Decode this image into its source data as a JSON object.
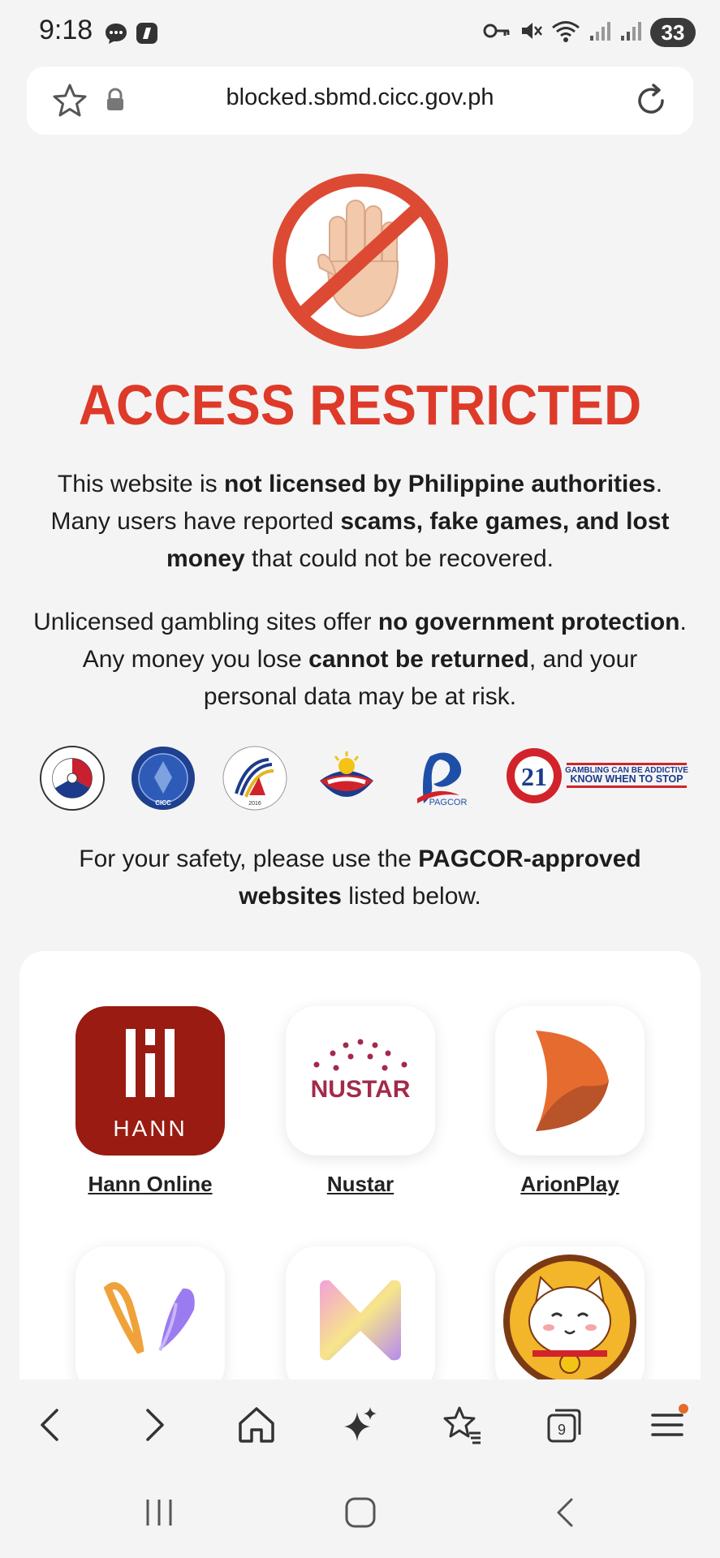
{
  "status_bar": {
    "time": "9:18",
    "left_icons": [
      "chat-bubble-icon",
      "app-notification-icon"
    ],
    "right_icons": [
      "vpn-key-icon",
      "mute-icon",
      "wifi-icon",
      "signal-icon",
      "signal-icon"
    ],
    "battery": "33"
  },
  "url_bar": {
    "url": "blocked.sbmd.cicc.gov.ph",
    "left_icons": [
      "star-icon",
      "lock-icon"
    ],
    "right_icon": "reload-icon"
  },
  "page": {
    "headline": "ACCESS RESTRICTED",
    "headline_color": "#de3a29",
    "para1": {
      "t1": "This website is ",
      "b1": "not licensed by Philippine authorities",
      "t2": ". Many users have reported ",
      "b2": "scams, fake games, and lost money",
      "t3": " that could not be recovered."
    },
    "para2": {
      "t1": "Unlicensed gambling sites offer ",
      "b1": "no government protection",
      "t2": ". Any money you lose ",
      "b2": "cannot be returned",
      "t3": ", and your personal data may be at risk."
    },
    "logos": {
      "ntc_text": "NATIONAL TELECOMMUNICATIONS COMMISSION",
      "cicc_text": "CICC",
      "dict_year": "2016",
      "pagcor_text": "PAGCOR",
      "age_number": "21",
      "warning_line1": "GAMBLING CAN BE ADDICTIVE",
      "warning_line2": "KNOW WHEN TO STOP"
    },
    "para3": {
      "t1": "For your safety, please use the ",
      "b1": "PAGCOR-approved websites",
      "t2": " listed below."
    }
  },
  "apps": [
    {
      "label": "Hann Online",
      "icon_text": "HANN"
    },
    {
      "label": "Nustar",
      "icon_text": "NUSTAR"
    },
    {
      "label": "ArionPlay"
    },
    {
      "label": ""
    },
    {
      "label": ""
    },
    {
      "label": ""
    }
  ],
  "toolbar": {
    "icons": [
      "back-icon",
      "forward-icon",
      "home-icon",
      "sparkle-icon",
      "bookmarks-icon",
      "tabs-icon",
      "menu-icon"
    ],
    "tab_count": "9"
  },
  "navbar": {
    "icons": [
      "recents-icon",
      "home-button-icon",
      "back-nav-icon"
    ]
  },
  "colors": {
    "accent_red": "#de3a29",
    "hann_red": "#9a1b12",
    "nustar_maroon": "#a32a4a",
    "arion_orange": "#e66b2e",
    "notification_dot": "#e56a2a"
  }
}
